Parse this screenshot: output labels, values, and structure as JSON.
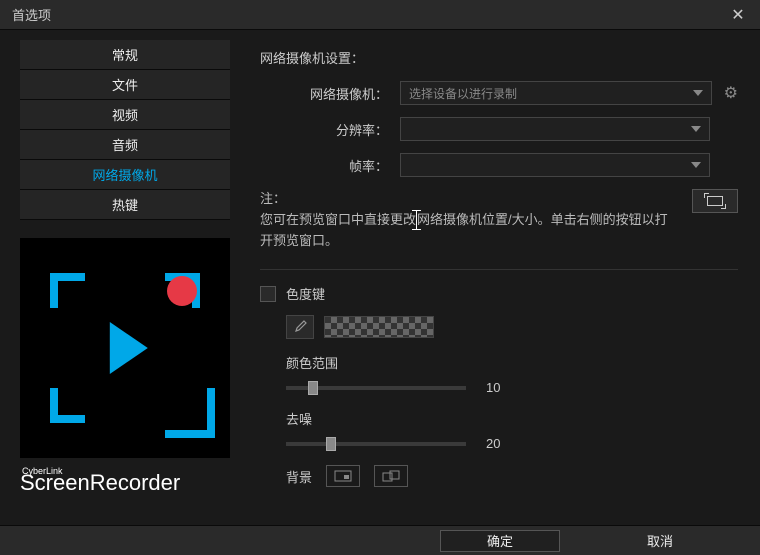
{
  "window": {
    "title": "首选项"
  },
  "sidebar": {
    "items": [
      {
        "label": "常规"
      },
      {
        "label": "文件"
      },
      {
        "label": "视频"
      },
      {
        "label": "音频"
      },
      {
        "label": "网络摄像机"
      },
      {
        "label": "热键"
      }
    ]
  },
  "product": {
    "brand": "CyberLink",
    "name": "ScreenRecorder"
  },
  "settings": {
    "section_title": "网络摄像机设置：",
    "webcam": {
      "label": "网络摄像机：",
      "placeholder": "选择设备以进行录制"
    },
    "resolution": {
      "label": "分辨率："
    },
    "framerate": {
      "label": "帧率："
    },
    "note_label": "注：",
    "note_text": "您可在预览窗口中直接更改网络摄像机位置/大小。单击右侧的按钮以打开预览窗口。",
    "chroma": {
      "label": "色度键"
    },
    "color_range": {
      "label": "颜色范围",
      "value": "10",
      "pct": 12
    },
    "denoise": {
      "label": "去噪",
      "value": "20",
      "pct": 22
    },
    "background": {
      "label": "背景"
    }
  },
  "footer": {
    "ok": "确定",
    "cancel": "取消"
  }
}
